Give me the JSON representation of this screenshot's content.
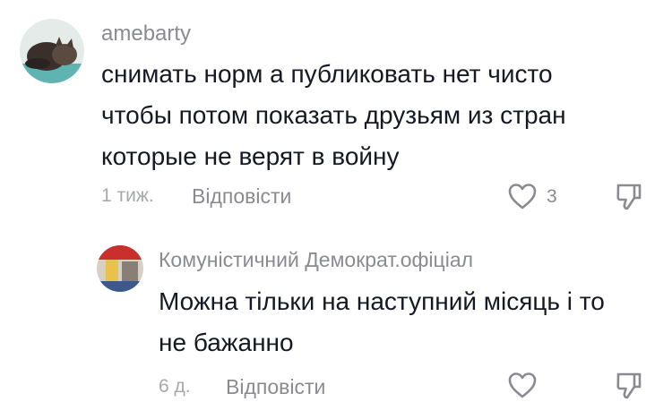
{
  "comments": [
    {
      "username": "amebarty",
      "text_lines": [
        "снимать норм а публиковать нет чисто",
        "чтобы потом показать друзьям из стран",
        "которые не верят в войну"
      ],
      "time": "1 тиж.",
      "reply_label": "Відповісти",
      "like_count": "3"
    },
    {
      "username": "Комуністичний Демократ.офіціал",
      "text_lines": [
        "Можна тільки на наступний місяць і то",
        "не бажанно"
      ],
      "time": "6 д.",
      "reply_label": "Відповісти",
      "like_count": ""
    }
  ],
  "icons": {
    "like": "heart-outline-icon",
    "dislike": "thumbs-down-outline-icon"
  },
  "colors": {
    "text": "#161823",
    "secondary": "#8a8b91",
    "tertiary": "#a7a8ac"
  }
}
